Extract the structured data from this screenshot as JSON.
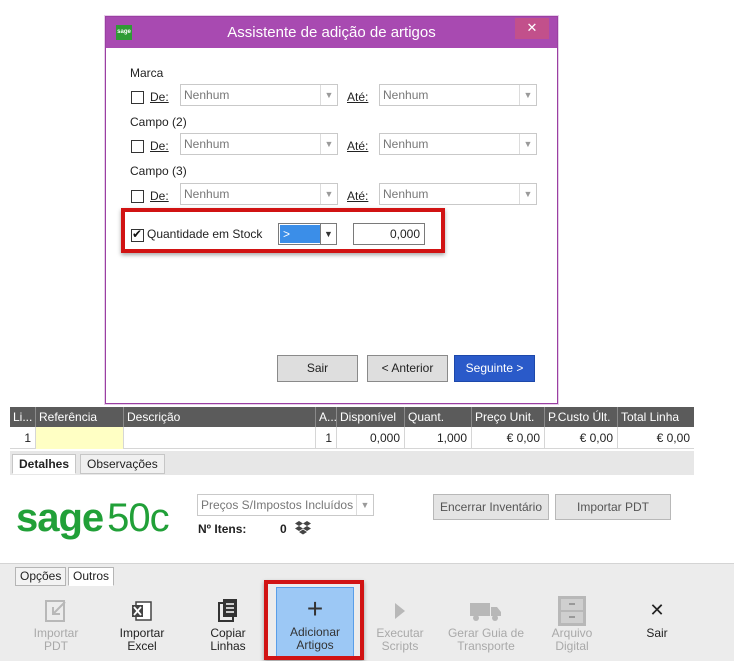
{
  "dialog": {
    "title": "Assistente de adição de artigos",
    "app_icon_text": "sage",
    "close_label": "✕",
    "groups": [
      {
        "label": "Marca",
        "from_label": "De:",
        "from_value": "Nenhum",
        "to_label": "Até:",
        "to_value": "Nenhum"
      },
      {
        "label": "Campo (2)",
        "from_label": "De:",
        "from_value": "Nenhum",
        "to_label": "Até:",
        "to_value": "Nenhum"
      },
      {
        "label": "Campo (3)",
        "from_label": "De:",
        "from_value": "Nenhum",
        "to_label": "Até:",
        "to_value": "Nenhum"
      }
    ],
    "stock": {
      "label": "Quantidade em Stock",
      "checked": true,
      "operator": ">",
      "value": "0,000"
    },
    "buttons": {
      "exit": "Sair",
      "previous": "< Anterior",
      "next": "Seguinte >"
    }
  },
  "grid": {
    "headers": [
      "Li...",
      "Referência",
      "Descrição",
      "A...",
      "Disponível",
      "Quant.",
      "Preço Unit.",
      "P.Custo Últ.",
      "Total Linha"
    ],
    "row": {
      "line": "1",
      "reference": "",
      "description": "",
      "a": "1",
      "available": "0,000",
      "quantity": "1,000",
      "unit_price": "€ 0,00",
      "last_cost": "€ 0,00",
      "total": "€ 0,00"
    },
    "tabs": [
      "Detalhes",
      "Observações"
    ]
  },
  "footer": {
    "logo_sage": "sage",
    "logo_50c": "50c",
    "price_select": "Preços S/Impostos Incluídos",
    "items_label": "Nº Itens:",
    "items_count": "0",
    "close_inventory": "Encerrar Inventário",
    "import_pdt": "Importar PDT"
  },
  "ribbon": {
    "tabs": [
      "Opções",
      "Outros"
    ],
    "buttons": [
      {
        "label": "Importar\nPDT",
        "icon": "import-arrow-icon",
        "enabled": false
      },
      {
        "label": "Importar\nExcel",
        "icon": "excel-icon",
        "enabled": true
      },
      {
        "label": "Copiar\nLinhas",
        "icon": "copy-icon",
        "enabled": true
      },
      {
        "label": "Adicionar\nArtigos",
        "icon": "plus-icon",
        "enabled": true
      },
      {
        "label": "Executar\nScripts",
        "icon": "play-icon",
        "enabled": false
      },
      {
        "label": "Gerar Guia de\nTransporte",
        "icon": "truck-icon",
        "enabled": false
      },
      {
        "label": "Arquivo\nDigital",
        "icon": "cabinet-icon",
        "enabled": false
      },
      {
        "label": "Sair",
        "icon": "close-icon",
        "enabled": true
      }
    ]
  },
  "colors": {
    "dialog_title_bar": "#a84ab1",
    "primary_button": "#2a5ac9",
    "highlight": "#d11313",
    "brand_green": "#21a038",
    "grid_header": "#5b5b5b"
  }
}
